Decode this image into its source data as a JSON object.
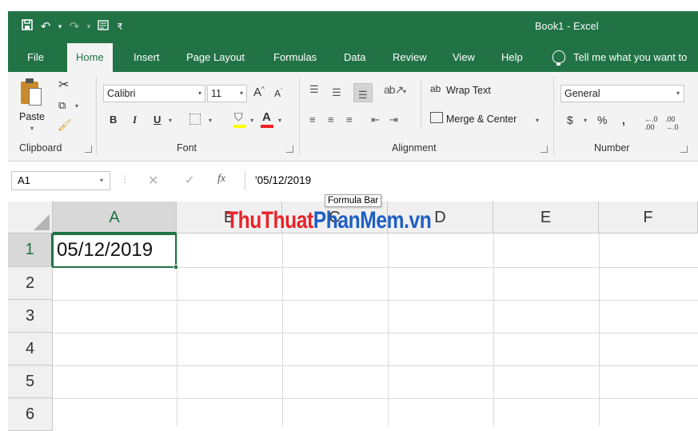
{
  "window": {
    "title": "Book1  -  Excel",
    "accent": "#217346"
  },
  "qat": {
    "save_icon": "save-icon",
    "undo_icon": "undo-icon",
    "redo_icon": "redo-icon",
    "form_icon": "form-icon",
    "customize_icon": "customize-qat-icon"
  },
  "tabs": [
    {
      "label": "File"
    },
    {
      "label": "Home"
    },
    {
      "label": "Insert"
    },
    {
      "label": "Page Layout"
    },
    {
      "label": "Formulas"
    },
    {
      "label": "Data"
    },
    {
      "label": "Review"
    },
    {
      "label": "View"
    },
    {
      "label": "Help"
    }
  ],
  "tellme": "Tell me what you want to",
  "ribbon": {
    "clipboard": {
      "paste_label": "Paste",
      "group_label": "Clipboard"
    },
    "font": {
      "font_name": "Calibri",
      "font_size": "11",
      "bold": "B",
      "italic": "I",
      "underline": "U",
      "font_color_letter": "A",
      "group_label": "Font"
    },
    "alignment": {
      "wrap_text": "Wrap Text",
      "merge_center": "Merge & Center",
      "group_label": "Alignment"
    },
    "number": {
      "format": "General",
      "currency": "$",
      "percent": "%",
      "comma": ",",
      "group_label": "Number"
    }
  },
  "formula_bar": {
    "name_box": "A1",
    "fx": "fx",
    "content": "'05/12/2019",
    "tooltip": "Formula Bar"
  },
  "grid": {
    "columns": [
      "A",
      "B",
      "C",
      "D",
      "E",
      "F"
    ],
    "rows": [
      "1",
      "2",
      "3",
      "4",
      "5",
      "6"
    ],
    "cell_a1": "05/12/2019"
  },
  "watermark": {
    "part1": "ThuThuat",
    "part2": "PhanMem",
    "part3": ".vn"
  }
}
